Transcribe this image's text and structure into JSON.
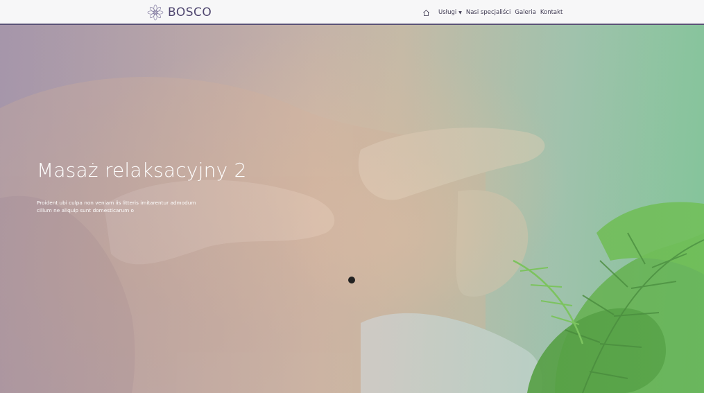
{
  "brand": {
    "name": "BOSCO",
    "icon": "lotus-mandala-icon"
  },
  "nav": {
    "home_icon": "home-icon",
    "items": [
      {
        "label": "Usługi",
        "has_dropdown": true
      },
      {
        "label": "Nasi specjaliści"
      },
      {
        "label": "Galeria"
      },
      {
        "label": "Kontakt"
      }
    ]
  },
  "hero": {
    "title": "Masaż relaksacyjny 2",
    "text": "Proident ubi culpa non veniam iis litteris imitarentur admodum cillum ne aliquip sunt domesticarum o"
  },
  "colors": {
    "brand": "#4f466f",
    "nav_border": "#5a5276",
    "leaf": "#5fae3c"
  }
}
